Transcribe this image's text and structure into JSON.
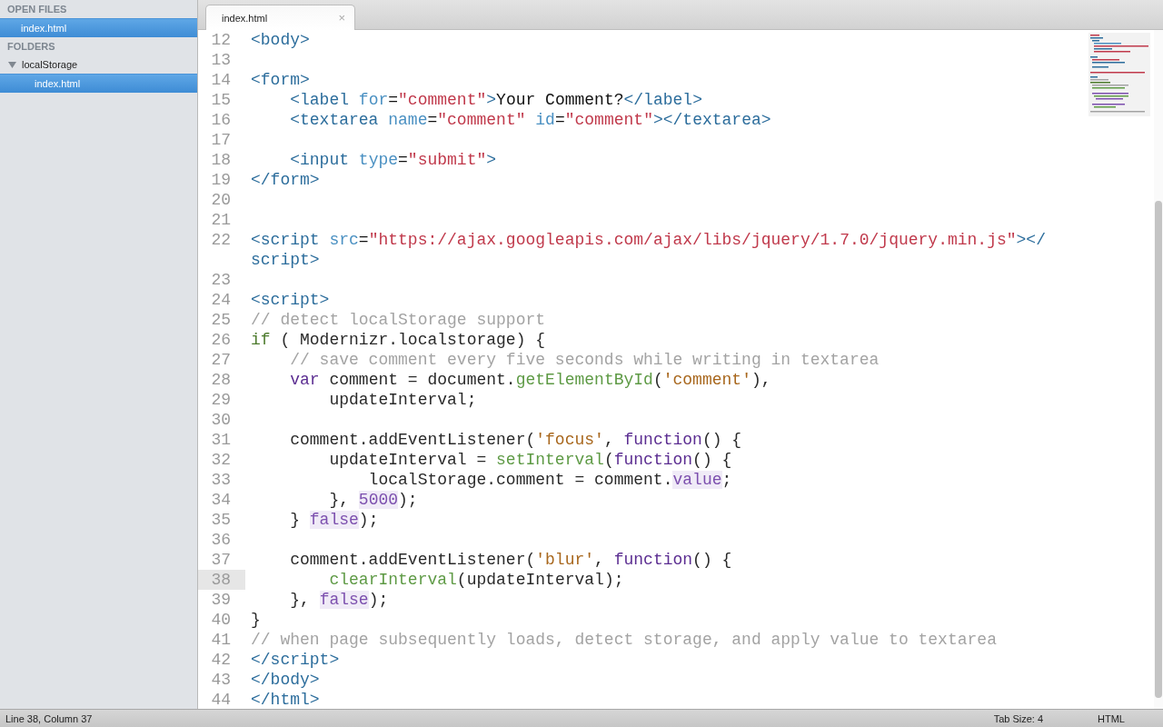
{
  "sidebar": {
    "open_files_header": "OPEN FILES",
    "open_files": [
      {
        "name": "index.html",
        "selected": true
      }
    ],
    "folders_header": "FOLDERS",
    "folders": [
      {
        "name": "localStorage",
        "expanded": true,
        "children": [
          {
            "name": "index.html",
            "selected": true
          }
        ]
      }
    ]
  },
  "tabs": [
    {
      "label": "index.html",
      "selected": true,
      "close": "×"
    }
  ],
  "lines": [
    {
      "number": "12",
      "current": false,
      "rows": [
        [
          {
            "kind": "tag",
            "text": "<body>"
          }
        ]
      ]
    },
    {
      "number": "13",
      "current": false
    },
    {
      "number": "14",
      "current": false,
      "rows": [
        [
          {
            "kind": "tag",
            "text": "<form>"
          }
        ]
      ]
    },
    {
      "number": "15",
      "current": false,
      "rows": [
        [
          {
            "kind": "tag",
            "text": "    <label "
          },
          {
            "kind": "attr",
            "text": "for"
          },
          {
            "kind": "text",
            "text": "="
          },
          {
            "kind": "str",
            "text": "\"comment\""
          },
          {
            "kind": "tag",
            "text": ">"
          },
          {
            "kind": "text",
            "text": "Your Comment?"
          },
          {
            "kind": "tag",
            "text": "</label>"
          }
        ]
      ]
    },
    {
      "number": "16",
      "current": false,
      "rows": [
        [
          {
            "kind": "tag",
            "text": "    <textarea "
          },
          {
            "kind": "attr",
            "text": "name"
          },
          {
            "kind": "text",
            "text": "="
          },
          {
            "kind": "str",
            "text": "\"comment\" "
          },
          {
            "kind": "attr",
            "text": "id"
          },
          {
            "kind": "text",
            "text": "="
          },
          {
            "kind": "str",
            "text": "\"comment\""
          },
          {
            "kind": "tag",
            "text": "></textarea>"
          }
        ]
      ]
    },
    {
      "number": "17",
      "current": false
    },
    {
      "number": "18",
      "current": false,
      "rows": [
        [
          {
            "kind": "tag",
            "text": "    <input "
          },
          {
            "kind": "attr",
            "text": "type"
          },
          {
            "kind": "text",
            "text": "="
          },
          {
            "kind": "str",
            "text": "\"submit\""
          },
          {
            "kind": "tag",
            "text": ">"
          }
        ]
      ]
    },
    {
      "number": "19",
      "current": false,
      "rows": [
        [
          {
            "kind": "tag",
            "text": "</form>"
          }
        ]
      ]
    },
    {
      "number": "20",
      "current": false
    },
    {
      "number": "21",
      "current": false
    },
    {
      "number": "22",
      "current": false,
      "rows": [
        [
          {
            "kind": "tag",
            "text": "<script "
          },
          {
            "kind": "attr",
            "text": "src"
          },
          {
            "kind": "text",
            "text": "="
          },
          {
            "kind": "str",
            "text": "\"https://ajax.googleapis.com/ajax/libs/jquery/1.7.0/jquery.min.js\""
          },
          {
            "kind": "tag",
            "text": "></"
          }
        ],
        [
          {
            "kind": "tag",
            "text": "script>"
          }
        ]
      ]
    },
    {
      "number": "23",
      "current": false
    },
    {
      "number": "24",
      "current": false,
      "rows": [
        [
          {
            "kind": "tag",
            "text": "<script>"
          }
        ]
      ]
    },
    {
      "number": "25",
      "current": false,
      "rows": [
        [
          {
            "kind": "comment",
            "text": "// detect localStorage support"
          }
        ]
      ]
    },
    {
      "number": "26",
      "current": false,
      "rows": [
        [
          {
            "kind": "control",
            "text": "if"
          },
          {
            "kind": "plain",
            "text": " ( Modernizr.localstorage) {"
          }
        ]
      ]
    },
    {
      "number": "27",
      "current": false,
      "rows": [
        [
          {
            "kind": "comment",
            "text": "    // save comment every five seconds while writing in textarea"
          }
        ]
      ]
    },
    {
      "number": "28",
      "current": false,
      "rows": [
        [
          {
            "kind": "plain",
            "text": "    "
          },
          {
            "kind": "keyword",
            "text": "var"
          },
          {
            "kind": "plain",
            "text": " comment = document."
          },
          {
            "kind": "func",
            "text": "getElementById"
          },
          {
            "kind": "plain",
            "text": "("
          },
          {
            "kind": "jsstr",
            "text": "'comment'"
          },
          {
            "kind": "plain",
            "text": "),"
          }
        ]
      ]
    },
    {
      "number": "29",
      "current": false,
      "rows": [
        [
          {
            "kind": "plain",
            "text": "        updateInterval;"
          }
        ]
      ]
    },
    {
      "number": "30",
      "current": false
    },
    {
      "number": "31",
      "current": false,
      "rows": [
        [
          {
            "kind": "plain",
            "text": "    comment.addEventListener("
          },
          {
            "kind": "jsstr",
            "text": "'focus'"
          },
          {
            "kind": "plain",
            "text": ", "
          },
          {
            "kind": "keyword",
            "text": "function"
          },
          {
            "kind": "plain",
            "text": "() {"
          }
        ]
      ]
    },
    {
      "number": "32",
      "current": false,
      "rows": [
        [
          {
            "kind": "plain",
            "text": "        updateInterval = "
          },
          {
            "kind": "func",
            "text": "setInterval"
          },
          {
            "kind": "plain",
            "text": "("
          },
          {
            "kind": "keyword",
            "text": "function"
          },
          {
            "kind": "plain",
            "text": "() {"
          }
        ]
      ]
    },
    {
      "number": "33",
      "current": false,
      "rows": [
        [
          {
            "kind": "plain",
            "text": "            localStorage.comment = comment."
          },
          {
            "kind": "const",
            "text": "value"
          },
          {
            "kind": "plain",
            "text": ";"
          }
        ]
      ]
    },
    {
      "number": "34",
      "current": false,
      "rows": [
        [
          {
            "kind": "plain",
            "text": "        }, "
          },
          {
            "kind": "const",
            "text": "5000"
          },
          {
            "kind": "plain",
            "text": ");"
          }
        ]
      ]
    },
    {
      "number": "35",
      "current": false,
      "rows": [
        [
          {
            "kind": "plain",
            "text": "    } "
          },
          {
            "kind": "const",
            "text": "false"
          },
          {
            "kind": "plain",
            "text": ");"
          }
        ]
      ]
    },
    {
      "number": "36",
      "current": false
    },
    {
      "number": "37",
      "current": false,
      "rows": [
        [
          {
            "kind": "plain",
            "text": "    comment.addEventListener("
          },
          {
            "kind": "jsstr",
            "text": "'blur'"
          },
          {
            "kind": "plain",
            "text": ", "
          },
          {
            "kind": "keyword",
            "text": "function"
          },
          {
            "kind": "plain",
            "text": "() {"
          }
        ]
      ]
    },
    {
      "number": "38",
      "current": true,
      "rows": [
        [
          {
            "kind": "plain",
            "text": "        "
          },
          {
            "kind": "func",
            "text": "clearInterval"
          },
          {
            "kind": "plain",
            "text": "(updateInterval);"
          }
        ]
      ]
    },
    {
      "number": "39",
      "current": false,
      "rows": [
        [
          {
            "kind": "plain",
            "text": "    }, "
          },
          {
            "kind": "const",
            "text": "false"
          },
          {
            "kind": "plain",
            "text": ");"
          }
        ]
      ]
    },
    {
      "number": "40",
      "current": false,
      "rows": [
        [
          {
            "kind": "plain",
            "text": "}"
          }
        ]
      ]
    },
    {
      "number": "41",
      "current": false,
      "rows": [
        [
          {
            "kind": "comment",
            "text": "// when page subsequently loads, detect storage, and apply value to textarea"
          }
        ]
      ]
    },
    {
      "number": "42",
      "current": false,
      "rows": [
        [
          {
            "kind": "tag",
            "text": "</script>"
          }
        ]
      ]
    },
    {
      "number": "43",
      "current": false,
      "rows": [
        [
          {
            "kind": "tag",
            "text": "</body>"
          }
        ]
      ]
    },
    {
      "number": "44",
      "current": false,
      "rows": [
        [
          {
            "kind": "tag",
            "text": "</html>"
          }
        ]
      ]
    }
  ],
  "status_bar": {
    "position": "Line 38, Column 37",
    "tab_size": "Tab Size: 4",
    "syntax": "HTML"
  }
}
